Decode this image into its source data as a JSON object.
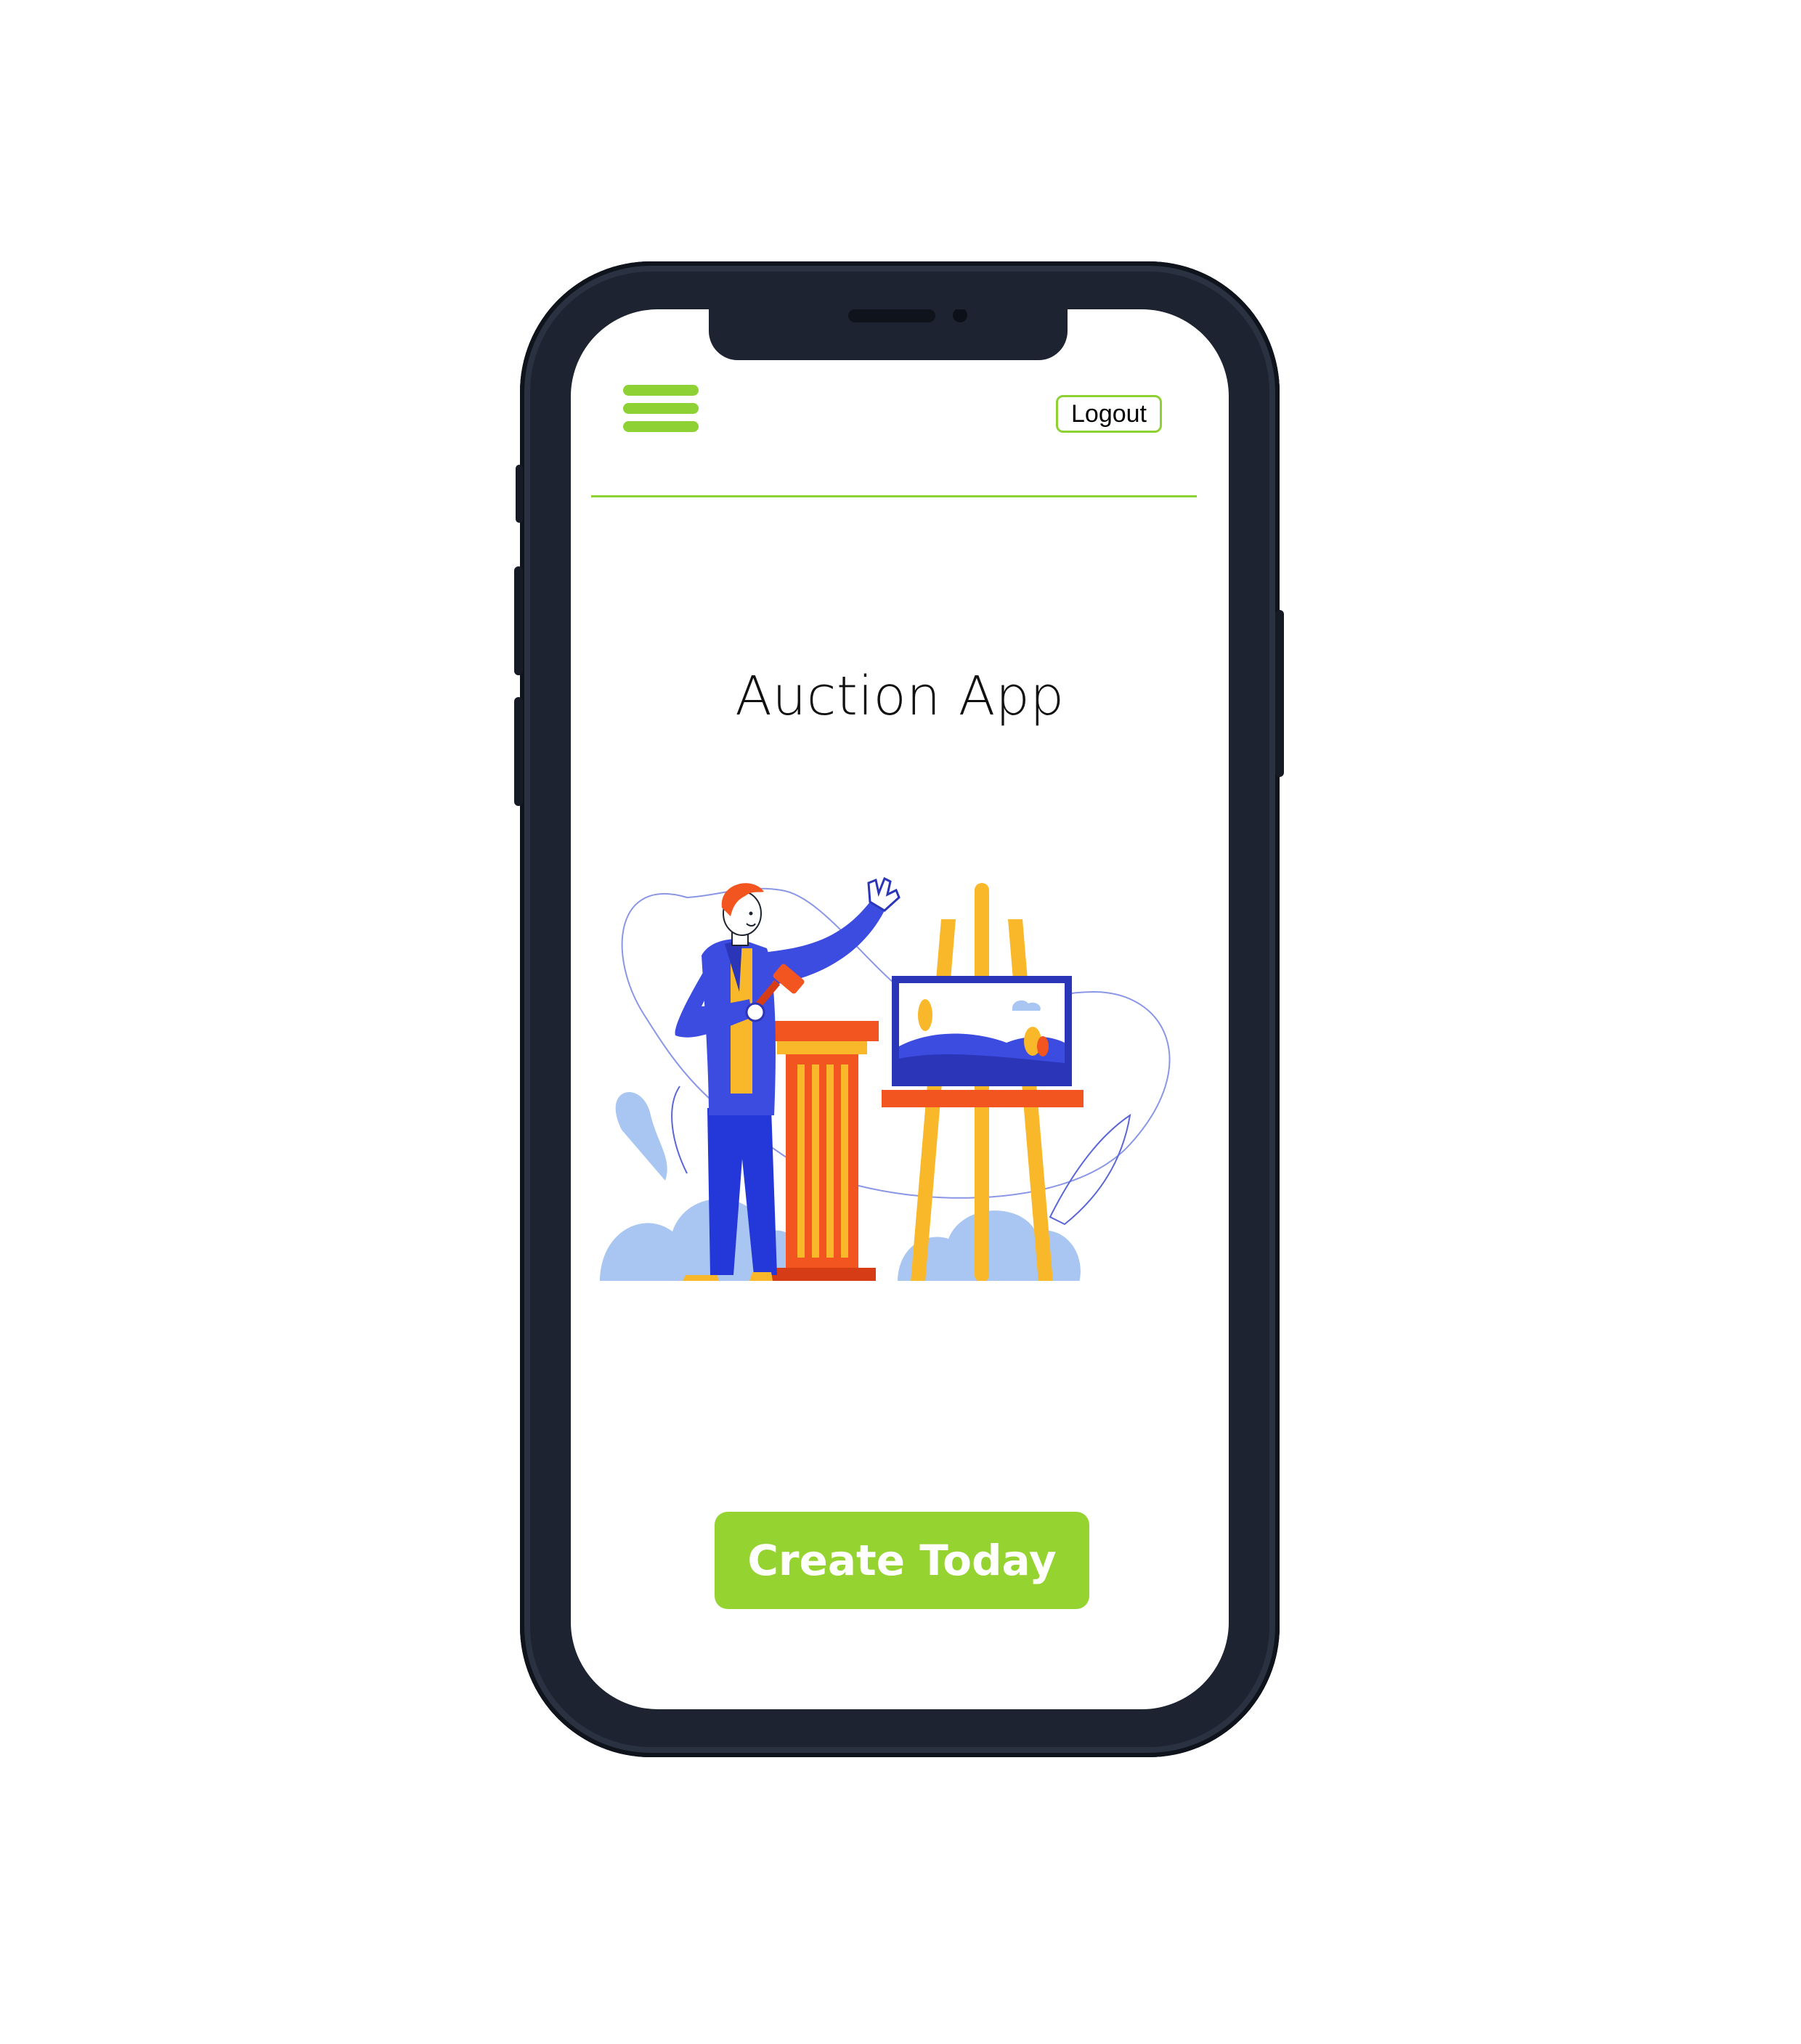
{
  "header": {
    "menu_icon": "hamburger-menu-icon",
    "logout_label": "Logout"
  },
  "main": {
    "title": "Auction App",
    "illustration": "auctioneer-with-easel-illustration",
    "cta_label": "Create Today"
  },
  "colors": {
    "accent": "#95d430",
    "primary_blue": "#3c4be0",
    "orange": "#f2551f",
    "yellow": "#f9b82a",
    "light_blue": "#a9c6f3",
    "phone_frame": "#1d2330"
  }
}
